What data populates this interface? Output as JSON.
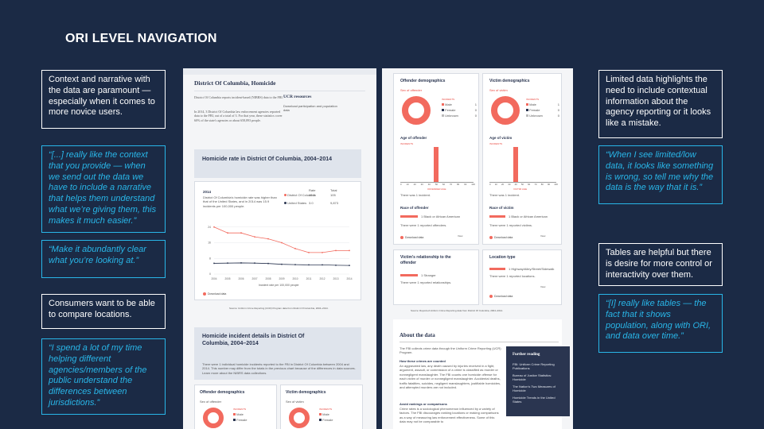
{
  "slide": {
    "title": "ORI LEVEL NAVIGATION",
    "left_notes": [
      "Context and narrative with the data are paramount — especially when it comes to more novice users.",
      "Consumers want to be able to compare locations."
    ],
    "left_quotes": [
      "“[...] really like the context that you provide — when we send out the data we have to include a narrative that helps them understand what we’re giving them, this makes it much easier.”",
      "“Make it abundantly clear what you’re looking at.”",
      "“I spend a lot of my time helping different agencies/members of the public understand the differences between jurisdictions.”"
    ],
    "right_notes": [
      "Limited data highlights the need to include contextual information about the agency reporting or it looks like a mistake.",
      "Tables are helpful but there is desire for more control or interactivity over them."
    ],
    "right_quotes": [
      "“When I see limited/low data, it looks like something is wrong, so tell me why the data is the way that it is.”",
      "“[I] really like tables — the fact that it shows population, along with ORI, and data over time.”"
    ]
  },
  "shot1": {
    "header": "District Of Columbia, Homicide",
    "intro_1": "District Of Columbia reports incident-based (NIBRS) data to the FBI.",
    "intro_2": "In 2014, 3 District Of Columbia law enforcement agencies reported data to the FBI, out of a total of 3. For that year, these statistics cover 60% of the state's agencies or about 658,893 people.",
    "ucr_title": "UCR resources",
    "ucr_link": "Download participation and population data",
    "rate_title": "Homicide rate in District Of Columbia, 2004–2014",
    "legend_year": "2014",
    "legend_text": "District Of Columbia's homicide rate was higher than that of the United States, and in 2014 was 15.9 incidents per 100,000 people.",
    "legend_col1": "Rate",
    "legend_col2": "Total",
    "legend_rows": [
      {
        "name": "District Of Columbia",
        "rate": "15.9",
        "total": "105"
      },
      {
        "name": "United States",
        "rate": "3.0",
        "total": "9,873"
      }
    ],
    "xaxis_caption": "Incident rate per 100,000 people",
    "download": "Download data",
    "source": "Source: Uniform Crime Reporting (UCR) Program data from District Of Columbia, 2004–2014.",
    "incident_title": "Homicide incident details in District Of Columbia, 2004–2014",
    "incident_text": "There were 1 individual homicide incidents reported to the FBI in District Of Columbia between 2004 and 2014. This number may differ from the totals in the previous chart because of the differences in data sources. Learn more about the NIBRS data collections.",
    "offender_title": "Offender demographics",
    "victim_title": "Victim demographics",
    "sex_offender": "Sex of offender",
    "sex_victim": "Sex of victim",
    "legend_small": [
      "Male",
      "Female"
    ]
  },
  "shot2": {
    "offender_title": "Offender demographics",
    "victim_title": "Victim demographics",
    "sex_offender": "Sex of offender",
    "sex_victim": "Sex of victim",
    "incidents": "INCIDENTS",
    "sex_rows": [
      {
        "label": "Male",
        "value": "1"
      },
      {
        "label": "Female",
        "value": "0"
      },
      {
        "label": "Unknown",
        "value": "0"
      }
    ],
    "age_offender": "Age of offender",
    "age_victim": "Age of victim",
    "offender_age_axis": "OFFENDER AGE",
    "victim_age_axis": "VICTIM AGE",
    "age_ticks": [
      "0",
      "10",
      "20",
      "30",
      "40",
      "50",
      "60",
      "70",
      "80",
      "90",
      "100"
    ],
    "one_incident": "There was 1 incident.",
    "race_offender": "Race of offender",
    "race_victim": "Race of victim",
    "race_value": "Black or African American",
    "race_count": "1",
    "race_offender_note": "There were 1 reported offenders.",
    "race_victim_note": "There were 1 reported victims.",
    "relationship_title": "Victim's relationship to the offender",
    "relationship_value": "Stranger",
    "relationship_note": "There were 1 reported relationships.",
    "location_title": "Location type",
    "location_value": "Highway/Alley/Street/Sidewalk",
    "location_note": "There were 1 reported locations.",
    "download": "Download data",
    "pager": "View",
    "source": "Source: Reported Uniform Crime Reporting data from District Of Columbia, 2004–2014.",
    "about_title": "About the data",
    "about_text": "The FBI collects crime data through the Uniform Crime Reporting (UCR) Program.",
    "how_title": "How these crimes are counted",
    "how_text": "An aggravated law, any death caused by injuries received in a fight, argument, assault, or commission of a crime is classified as murder or nonnegligent manslaughter. The FBI counts one homicide offense for each victim of murder or nonnegligent manslaughter. Accidental deaths, traffic fatalities, suicides, negligent manslaughters, justifiable homicides, and attempted murders are not included.",
    "rankings_title": "Avoid rankings or comparisons",
    "rankings_text": "Crime rates is a sociological phenomenon influenced by a variety of factors. The FBI discourages ranking locations or making comparisons as a way of measuring law enforcement effectiveness. Some of this data may not be comparable to",
    "further_title": "Further reading",
    "further_items": [
      "FBI: Uniform Crime Reporting Publications",
      "Bureau of Justice Statistics: Homicide",
      "The Nation's Two Measures of Homicide",
      "Homicide Trends in the United States"
    ]
  },
  "chart_data": {
    "type": "line",
    "x": [
      "2004",
      "2005",
      "2006",
      "2007",
      "2008",
      "2009",
      "2010",
      "2011",
      "2012",
      "2013",
      "2014"
    ],
    "yticks": [
      "0",
      "8",
      "16",
      "24"
    ],
    "series": [
      {
        "name": "District Of Columbia",
        "values": [
          24,
          21,
          21,
          19,
          18,
          16,
          13,
          11,
          11,
          12,
          12
        ],
        "color": "#f26a5e"
      },
      {
        "name": "United States",
        "values": [
          5.5,
          5.6,
          5.7,
          5.6,
          5.4,
          5,
          4.8,
          4.7,
          4.7,
          4.5,
          4.4
        ],
        "color": "#2a3550"
      }
    ],
    "ylim": [
      0,
      30
    ]
  },
  "colors": {
    "background": "#1b2a45",
    "quote": "#29b6e8",
    "accent": "#f26a5e"
  }
}
